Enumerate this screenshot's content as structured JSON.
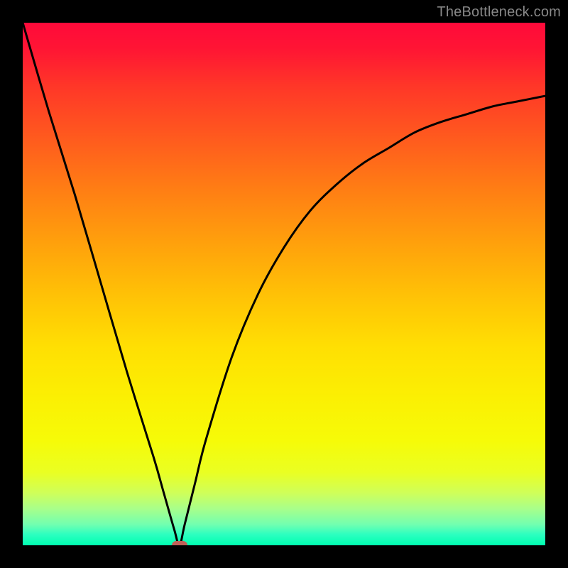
{
  "watermark": "TheBottleneck.com",
  "colors": {
    "frame": "#000000",
    "curve": "#000000",
    "marker": "#c06058",
    "gradient_top": "#ff0a3a",
    "gradient_bottom": "#00ffb0"
  },
  "chart_data": {
    "type": "line",
    "title": "",
    "xlabel": "",
    "ylabel": "",
    "xlim": [
      0,
      100
    ],
    "ylim": [
      0,
      100
    ],
    "grid": false,
    "legend": false,
    "background": "vertical-gradient red→green (bottleneck heatmap)",
    "series": [
      {
        "name": "bottleneck-curve",
        "x": [
          0,
          5,
          10,
          15,
          20,
          25,
          27,
          29,
          30,
          31,
          33,
          35,
          40,
          45,
          50,
          55,
          60,
          65,
          70,
          75,
          80,
          85,
          90,
          95,
          100
        ],
        "y": [
          100,
          83,
          67,
          50,
          33,
          17,
          10,
          3,
          0,
          4,
          12,
          20,
          36,
          48,
          57,
          64,
          69,
          73,
          76,
          79,
          81,
          82.5,
          84,
          85,
          86
        ]
      }
    ],
    "annotations": [
      {
        "name": "optimum-marker",
        "shape": "pill",
        "x": 30,
        "y": 0,
        "color": "#c06058"
      }
    ]
  }
}
